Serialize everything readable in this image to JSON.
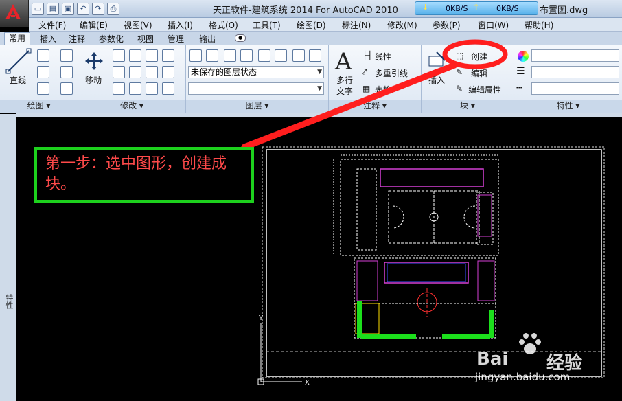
{
  "window": {
    "title": "天正软件-建筑系统 2014  For AutoCAD 2010",
    "title_tail": "布置图.dwg",
    "net_down": "0KB/S",
    "net_up": "0KB/S"
  },
  "menu": [
    "文件(F)",
    "编辑(E)",
    "视图(V)",
    "插入(I)",
    "格式(O)",
    "工具(T)",
    "绘图(D)",
    "标注(N)",
    "修改(M)",
    "参数(P)",
    "窗口(W)",
    "帮助(H)"
  ],
  "tabs": [
    "常用",
    "插入",
    "注释",
    "参数化",
    "视图",
    "管理",
    "输出"
  ],
  "ribbon": {
    "draw_line": "直线",
    "modify_move": "移动",
    "layer_state": "未保存的图层状态",
    "text_big1": "多行",
    "text_big2": "文字",
    "annot_linear": "线性",
    "annot_mleader": "多重引线",
    "annot_table": "表格",
    "block_insert": "插入",
    "block_create": "创建",
    "block_edit": "编辑",
    "block_attr": "编辑属性",
    "groups": {
      "draw": "绘图",
      "modify": "修改",
      "layer": "图层",
      "annotation": "注释",
      "block": "块",
      "properties": "特性"
    }
  },
  "side_panel": "特性",
  "instruction": "第一步：选中图形，创建成块。",
  "watermark": {
    "brand": "Bai",
    "brand2": "经验",
    "url": "jingyan.baidu.com"
  },
  "colors": {
    "highlight_red": "#ff1e1e",
    "note_green": "#1dd11d",
    "note_text": "#ff4a4a"
  }
}
